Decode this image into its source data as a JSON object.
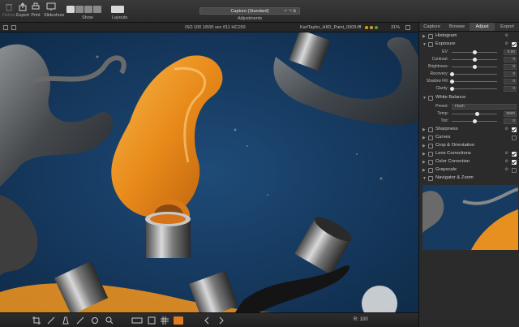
{
  "toolbar": {
    "delete_label": "Delete",
    "export_label": "Export",
    "print_label": "Print",
    "slideshow_label": "Slideshow",
    "show_label": "Show",
    "layouts_label": "Layouts",
    "preset_value": "Capture (Standard)",
    "adjustments_label": "Adjustments"
  },
  "infobar": {
    "exif": "ISO 100   1/500 sec   f/11   HC150",
    "filename": "KarlTaylor_HIID_Paint_0009.fff",
    "zoom": "31%"
  },
  "bottombar": {
    "zoom_value": "100"
  },
  "panel": {
    "tabs": [
      "Capture",
      "Browse",
      "Adjust",
      "Export"
    ],
    "active_tab": "Adjust",
    "sections": {
      "histogram": "Histogram",
      "exposure": "Exposure",
      "white_balance": "White Balance",
      "sharpness": "Sharpness",
      "curves": "Curves",
      "crop": "Crop & Orientation",
      "lens": "Lens Corrections",
      "color": "Color Correction",
      "grayscale": "Grayscale",
      "navigator": "Navigator & Zoom"
    },
    "exposure_rows": [
      {
        "label": "EV:",
        "value": "0.00",
        "level": 0.5
      },
      {
        "label": "Contrast:",
        "value": "0",
        "level": 0.5
      },
      {
        "label": "Brightness:",
        "value": "0",
        "level": 0.5
      },
      {
        "label": "Recovery:",
        "value": "0",
        "level": 0.0
      },
      {
        "label": "Shadow Fill:",
        "value": "0",
        "level": 0.0
      },
      {
        "label": "Clarity:",
        "value": "0",
        "level": 0.0
      }
    ],
    "wb": {
      "preset_label": "Preset:",
      "preset_value": "Flash",
      "temp_label": "Temp:",
      "temp_value": "5500",
      "temp_level": 0.55,
      "tint_label": "Tint:",
      "tint_value": "0",
      "tint_level": 0.5
    }
  },
  "colors": {
    "background_blue": "#173c63",
    "paint_orange": "#e88a1a",
    "accent_orange": "#e07b22"
  }
}
